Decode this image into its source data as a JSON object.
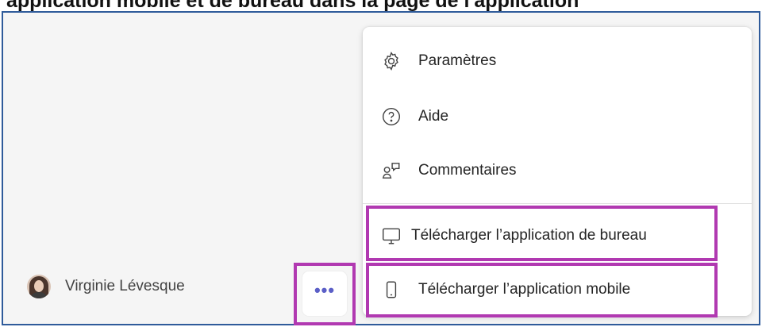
{
  "caption": "application mobile et de bureau dans la page de l'application",
  "user": {
    "name": "Virginie Lévesque"
  },
  "more_button": {
    "label": "•••"
  },
  "menu": {
    "items": [
      {
        "id": "settings",
        "label": "Paramètres",
        "icon": "gear-icon"
      },
      {
        "id": "help",
        "label": "Aide",
        "icon": "help-circle-icon"
      },
      {
        "id": "feedback",
        "label": "Commentaires",
        "icon": "feedback-icon"
      },
      {
        "id": "desktop",
        "label": "Télécharger l’application de bureau",
        "icon": "desktop-icon"
      },
      {
        "id": "mobile",
        "label": "Télécharger l’application mobile",
        "icon": "phone-icon"
      }
    ]
  },
  "colors": {
    "highlight": "#b139b1",
    "accent": "#5b5fc7",
    "frame_border": "#2f5b9a"
  }
}
